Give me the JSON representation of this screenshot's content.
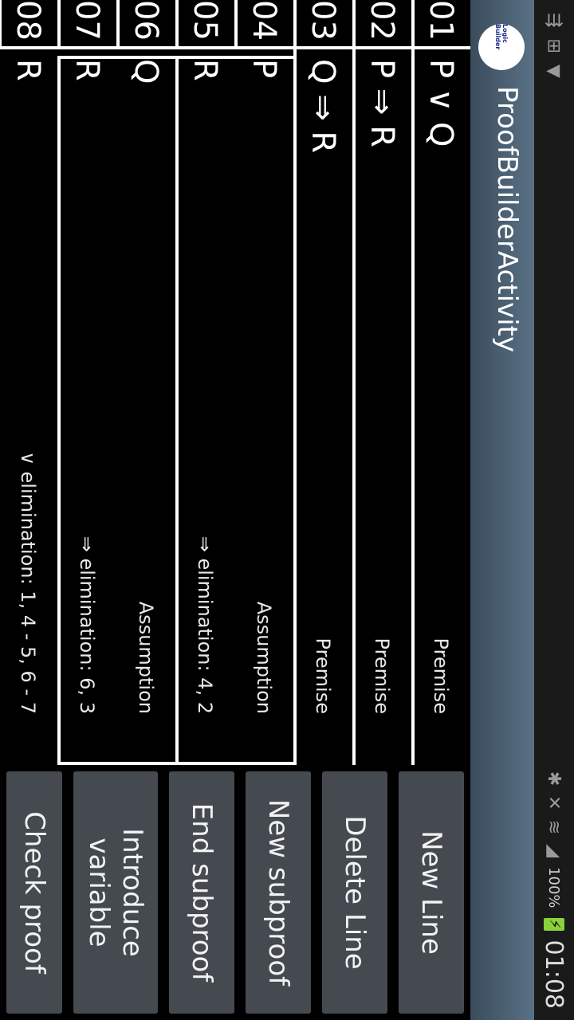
{
  "status_bar": {
    "time": "01:08",
    "battery": "100%",
    "icons": [
      "usb-icon",
      "screenshot-icon",
      "download-icon",
      "bluetooth-icon",
      "mute-icon",
      "wifi-icon",
      "signal-icon"
    ]
  },
  "app": {
    "title": "ProofBuilderActivity",
    "logo_text": "Logic Builder"
  },
  "proof": {
    "lines": [
      {
        "num": "01",
        "formula": "P ∨ Q",
        "rule": "Premise"
      },
      {
        "num": "02",
        "formula": "P ⇒ R",
        "rule": "Premise"
      },
      {
        "num": "03",
        "formula": "Q ⇒ R",
        "rule": "Premise"
      },
      {
        "num": "04",
        "formula": "P",
        "rule": "Assumption"
      },
      {
        "num": "05",
        "formula": "R",
        "rule": "⇒ elimination: 4, 2"
      },
      {
        "num": "06",
        "formula": "Q",
        "rule": "Assumption"
      },
      {
        "num": "07",
        "formula": "R",
        "rule": "⇒ elimination: 6, 3"
      },
      {
        "num": "08",
        "formula": "R",
        "rule": "∨ elimination: 1, 4 - 5, 6 - 7"
      }
    ]
  },
  "buttons": {
    "new_line": "New Line",
    "delete_line": "Delete Line",
    "new_subproof": "New subproof",
    "end_subproof": "End subproof",
    "introduce_variable": "Introduce variable",
    "check_proof": "Check proof"
  },
  "colors": {
    "titlebar": "#4a6072",
    "button": "#444a50",
    "background": "#000000",
    "battery_charge": "#8bd13a"
  }
}
